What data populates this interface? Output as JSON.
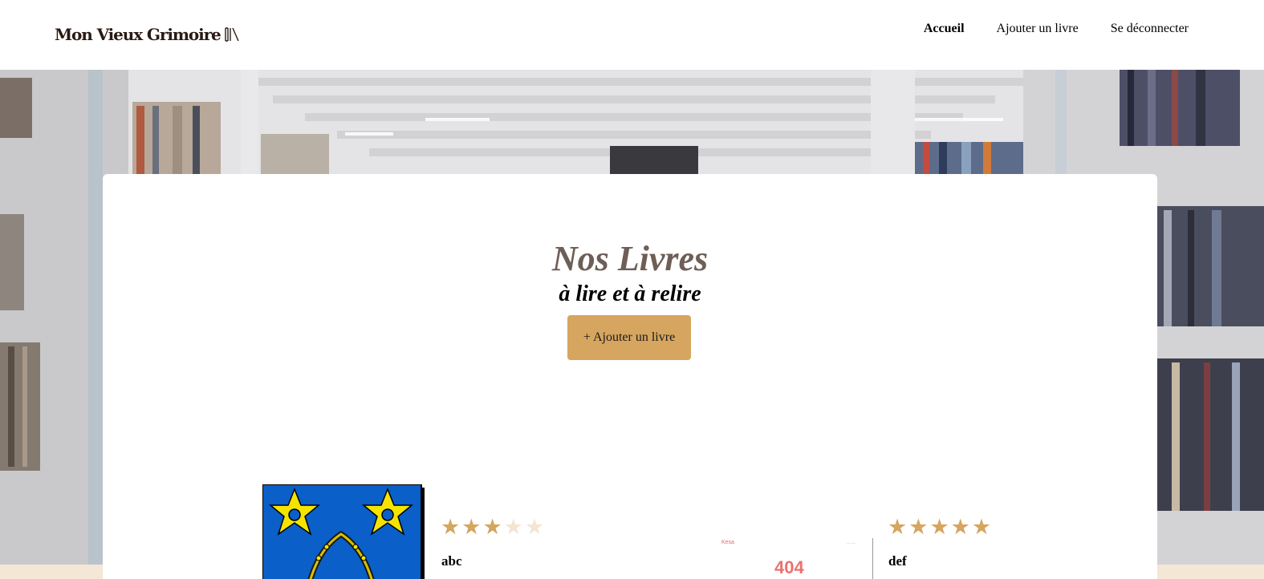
{
  "header": {
    "logo_text": "Mon Vieux Grimoire",
    "nav": [
      {
        "label": "Accueil",
        "active": true
      },
      {
        "label": "Ajouter un livre",
        "active": false
      },
      {
        "label": "Se déconnecter",
        "active": false
      }
    ]
  },
  "main": {
    "title": "Nos Livres",
    "subtitle": "à lire et à relire",
    "add_button_label": "+ Ajouter un livre"
  },
  "books": [
    {
      "title": "abc",
      "rating": 3,
      "max_rating": 5,
      "cover": "coat-of-arms-image"
    },
    {
      "title": "def",
      "rating": 5,
      "max_rating": 5,
      "cover": "broken-404-image",
      "cover_text": {
        "small": "Kesa",
        "tiny": "··· ···",
        "code": "404"
      }
    }
  ],
  "colors": {
    "accent": "#d6a55f",
    "star_empty": "#f3e5d2",
    "title_color": "#6e5e56",
    "error_red": "#e8736f"
  },
  "star_glyph": "★"
}
